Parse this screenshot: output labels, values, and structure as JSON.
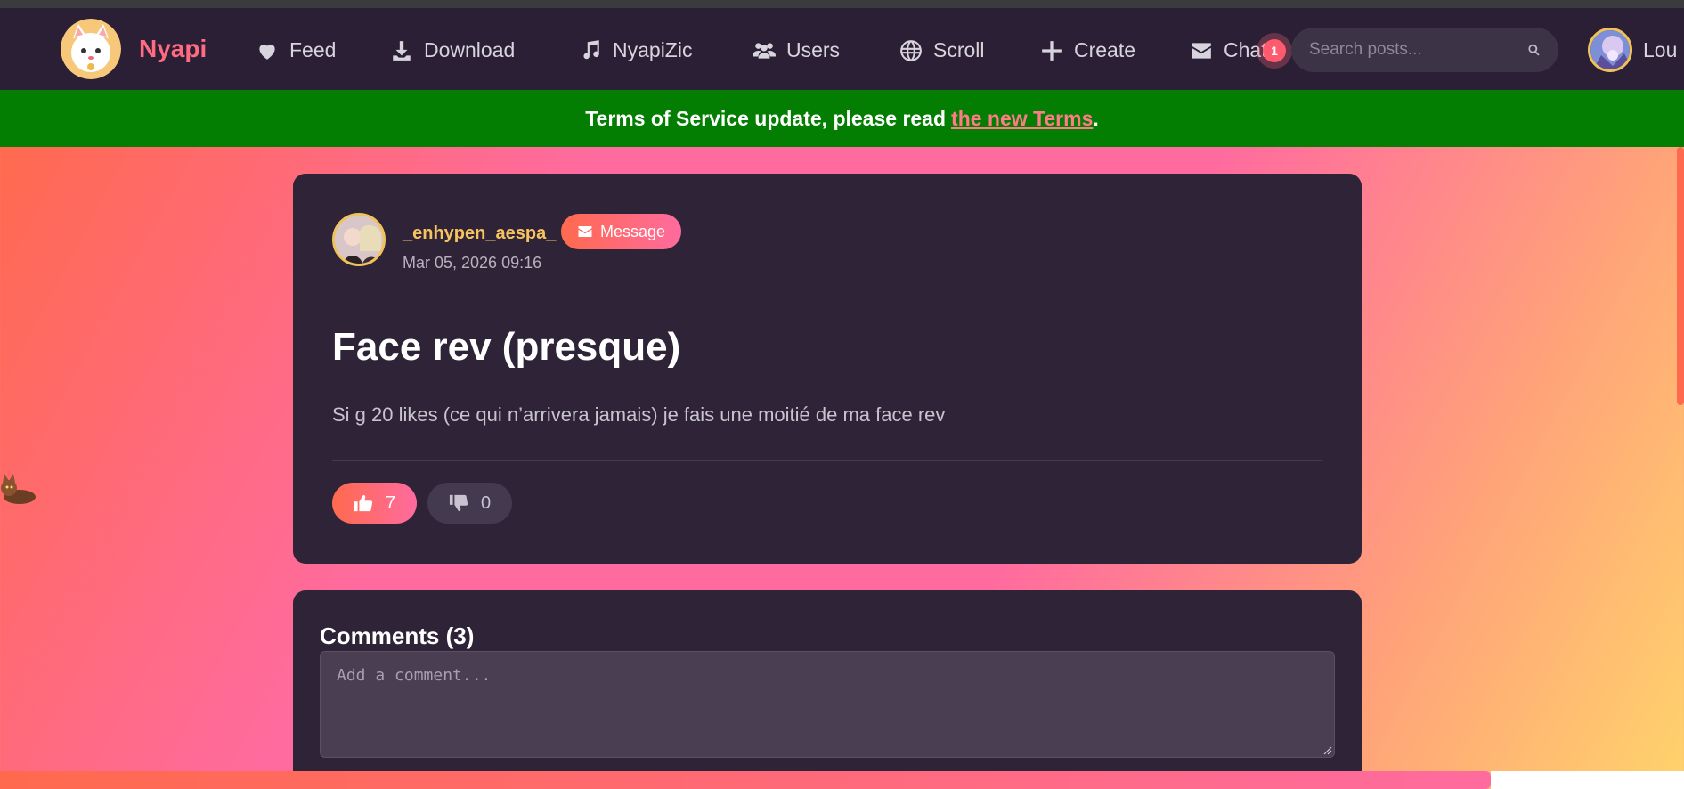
{
  "app": {
    "brand_name": "Nyapi"
  },
  "nav": {
    "items": [
      {
        "label": "Feed",
        "icon": "heart-icon"
      },
      {
        "label": "Download",
        "icon": "download-icon"
      },
      {
        "label": "NyapiZic",
        "icon": "music-icon"
      },
      {
        "label": "Users",
        "icon": "users-icon"
      },
      {
        "label": "Scroll",
        "icon": "globe-icon"
      },
      {
        "label": "Create",
        "icon": "plus-icon"
      },
      {
        "label": "Chats",
        "icon": "envelope-icon"
      }
    ],
    "chat_unread_count": "1",
    "search_placeholder": "Search posts...",
    "user_name": "Lou"
  },
  "banner": {
    "text": "Terms of Service update, please read",
    "link_text": "the new Terms",
    "suffix": "."
  },
  "post": {
    "author": "_enhypen_aespa_",
    "message_button": "Message",
    "date": "Mar 05, 2026 09:16",
    "title": "Face rev (presque)",
    "body": "Si g 20 likes (ce qui n’arrivera jamais) je fais une moitié de ma face rev",
    "likes": "7",
    "dislikes": "0"
  },
  "comments": {
    "title": "Comments (3)",
    "placeholder": "Add a comment..."
  },
  "colors": {
    "accent": "#ff6b81",
    "banner_green": "#037e03",
    "card_bg": "#2e2337",
    "navbar_bg": "#2a1f34",
    "author_gold": "#f7c35e"
  }
}
